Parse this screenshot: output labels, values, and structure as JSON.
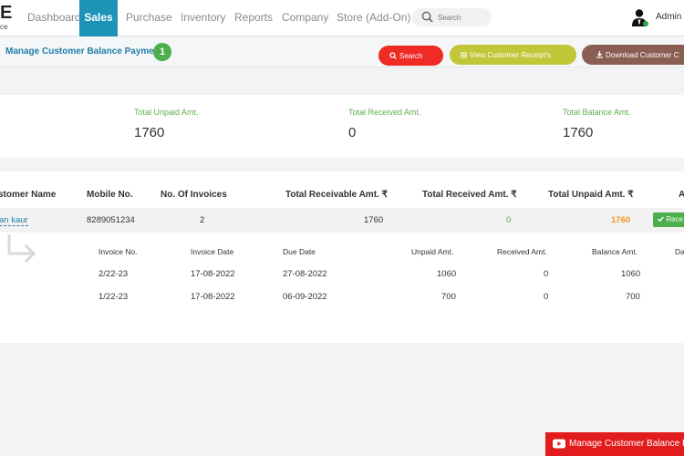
{
  "logo": {
    "big": "E",
    "small": "ce"
  },
  "nav": {
    "items": [
      {
        "label": "Dashboard"
      },
      {
        "label": "Sales"
      },
      {
        "label": "Purchase"
      },
      {
        "label": "Inventory"
      },
      {
        "label": "Reports"
      },
      {
        "label": "Company"
      },
      {
        "label": "Store (Add-On)"
      }
    ],
    "search_placeholder": "Search",
    "user_name": "Admin",
    "colors": {
      "active": "#1c93b7"
    }
  },
  "header": {
    "title": "Manage Customer Balance Payments",
    "badge": "1",
    "buttons": {
      "search": "Search",
      "view_receipts": "View Customer Receipt's",
      "download": "Download Customer C"
    }
  },
  "totals": [
    {
      "label": "Total Unpaid Amt.",
      "value": "1760"
    },
    {
      "label": "Total Received Amt.",
      "value": "0"
    },
    {
      "label": "Total Balance Amt.",
      "value": "1760"
    }
  ],
  "table": {
    "headers": {
      "customer": "stomer Name",
      "mobile": "Mobile No.",
      "invoices": "No. Of Invoices",
      "receivable": "Total Receivable Amt. ₹",
      "received": "Total Received Amt. ₹",
      "unpaid": "Total Unpaid Amt. ₹",
      "action": "A"
    },
    "row": {
      "customer": "an kaur",
      "mobile": "8289051234",
      "invoices": "2",
      "receivable": "1760",
      "received": "0",
      "unpaid": "1760",
      "action": "Rece"
    }
  },
  "subtable": {
    "headers": {
      "invoice_no": "Invoice No.",
      "invoice_date": "Invoice Date",
      "due_date": "Due Date",
      "unpaid": "Unpaid Amt.",
      "received": "Received Amt.",
      "balance": "Balance Amt.",
      "extra": "Da"
    },
    "rows": [
      {
        "invoice_no": "2/22-23",
        "invoice_date": "17-08-2022",
        "due_date": "27-08-2022",
        "unpaid": "1060",
        "received": "0",
        "balance": "1060"
      },
      {
        "invoice_no": "1/22-23",
        "invoice_date": "17-08-2022",
        "due_date": "06-09-2022",
        "unpaid": "700",
        "received": "0",
        "balance": "700"
      }
    ]
  },
  "footer": {
    "help_button": "Manage Customer Balance P"
  }
}
